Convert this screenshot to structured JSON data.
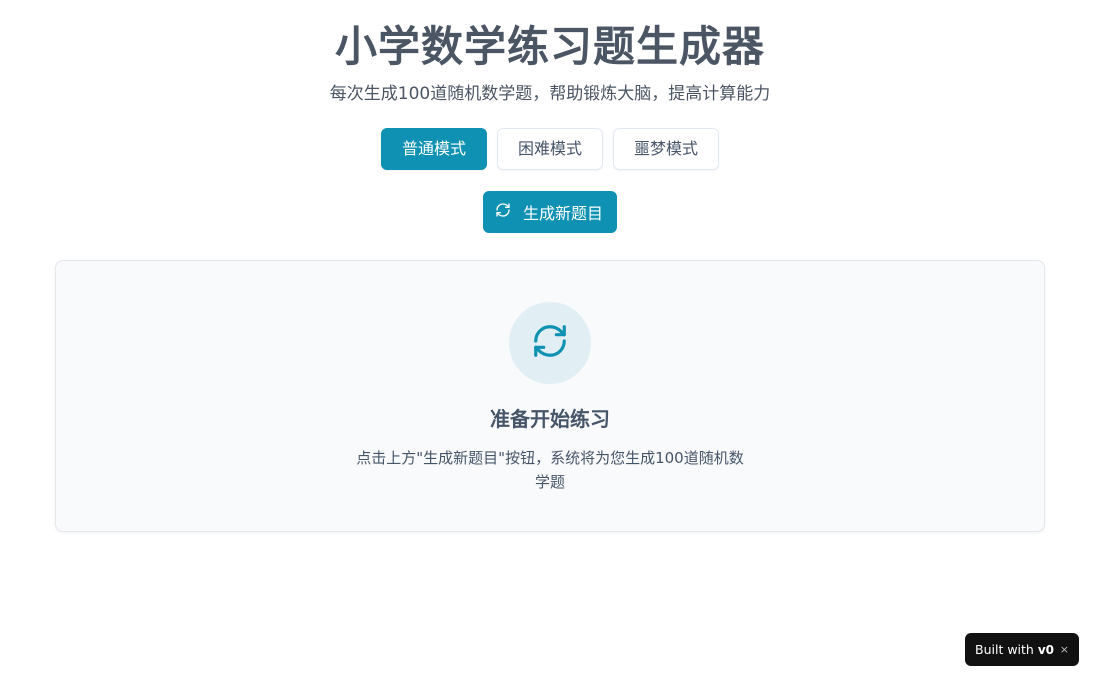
{
  "header": {
    "title": "小学数学练习题生成器",
    "subtitle": "每次生成100道随机数学题，帮助锻炼大脑，提高计算能力"
  },
  "modes": [
    {
      "label": "普通模式",
      "active": true
    },
    {
      "label": "困难模式",
      "active": false
    },
    {
      "label": "噩梦模式",
      "active": false
    }
  ],
  "generate": {
    "label": "生成新题目",
    "icon": "refresh-icon"
  },
  "card": {
    "icon": "refresh-icon",
    "title": "准备开始练习",
    "description": "点击上方\"生成新题目\"按钮，系统将为您生成100道随机数学题"
  },
  "badge": {
    "label": "Built with",
    "logo": "v0",
    "close": "×"
  },
  "colors": {
    "accent": "#0e91b2",
    "card_bg": "#f8fafc",
    "icon_circle": "#e1eff4"
  }
}
